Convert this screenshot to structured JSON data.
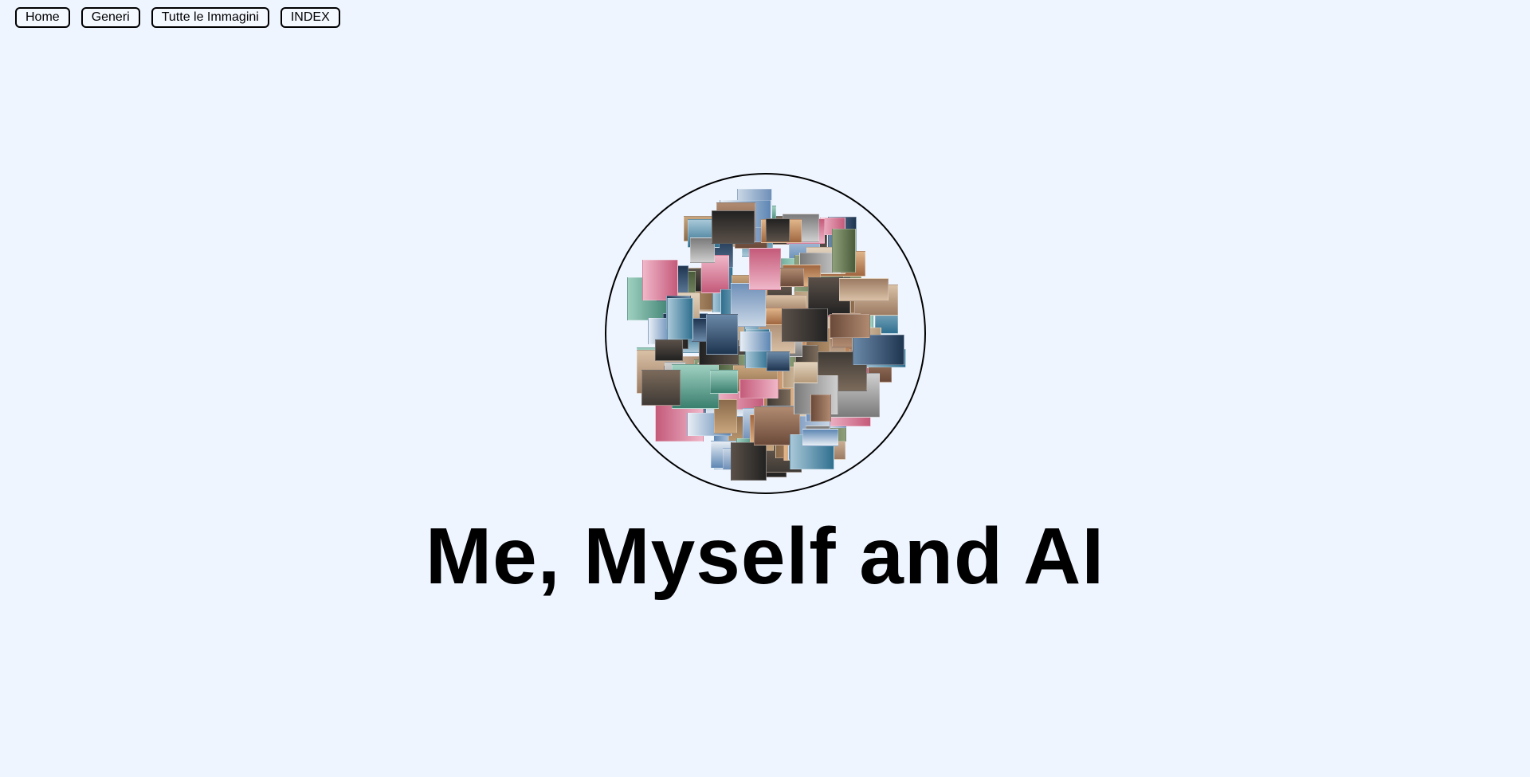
{
  "nav": {
    "items": [
      {
        "label": "Home"
      },
      {
        "label": "Generi"
      },
      {
        "label": "Tutte le Immagini"
      },
      {
        "label": "INDEX"
      }
    ]
  },
  "hero": {
    "title": "Me, Myself and AI"
  },
  "colors": {
    "background": "#eef5ff",
    "text": "#000000"
  }
}
